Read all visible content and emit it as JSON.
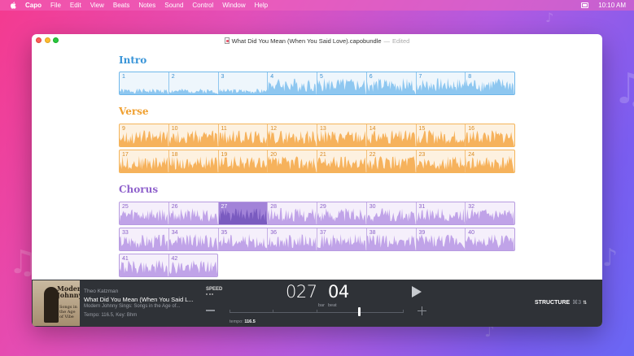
{
  "menubar": {
    "app": "Capo",
    "items": [
      "File",
      "Edit",
      "View",
      "Beats",
      "Notes",
      "Sound",
      "Control",
      "Window",
      "Help"
    ],
    "clock": "10:10 AM"
  },
  "window": {
    "filename": "What Did You Mean (When You Said Love).capobundle",
    "separator": "—",
    "edited": "Edited"
  },
  "sections": [
    {
      "name": "Intro",
      "color": "#3a95d8",
      "rows": [
        [
          1,
          2,
          3,
          4,
          5,
          6,
          7,
          8
        ]
      ]
    },
    {
      "name": "Verse",
      "color": "#f0a030",
      "rows": [
        [
          9,
          10,
          11,
          12,
          13,
          14,
          15,
          16
        ],
        [
          17,
          18,
          19,
          20,
          21,
          22,
          23,
          24
        ]
      ]
    },
    {
      "name": "Chorus",
      "color": "#8f62cc",
      "rows": [
        [
          25,
          26,
          27,
          28,
          29,
          30,
          31,
          32
        ],
        [
          33,
          34,
          35,
          36,
          37,
          38,
          39,
          40
        ],
        [
          41,
          42
        ]
      ]
    }
  ],
  "selected_bar": 27,
  "now_playing": {
    "artist": "Theo Katzman",
    "song": "What Did You Mean (When You Said L...",
    "album": "Modern Johnny Sings: Songs in the Age of...",
    "tempo_key": "Tempo: 116.5, Key: Bhm",
    "album_art_text_1": "Modern Johnny",
    "album_art_text_2": "Songs in the Age of Vibe"
  },
  "transport": {
    "speed_label": "SPEED",
    "bar_value": "027",
    "bar_label": "bar",
    "beat_value": "04",
    "beat_label": "beat",
    "tempo_label": "tempo:",
    "tempo_value": "116.5",
    "structure_label": "STRUCTURE",
    "structure_shortcut": "⌘3",
    "structure_arrows": "⌃",
    "play_icon": "play-icon",
    "minus_icon": "minus-icon",
    "plus_icon": "plus-icon"
  }
}
